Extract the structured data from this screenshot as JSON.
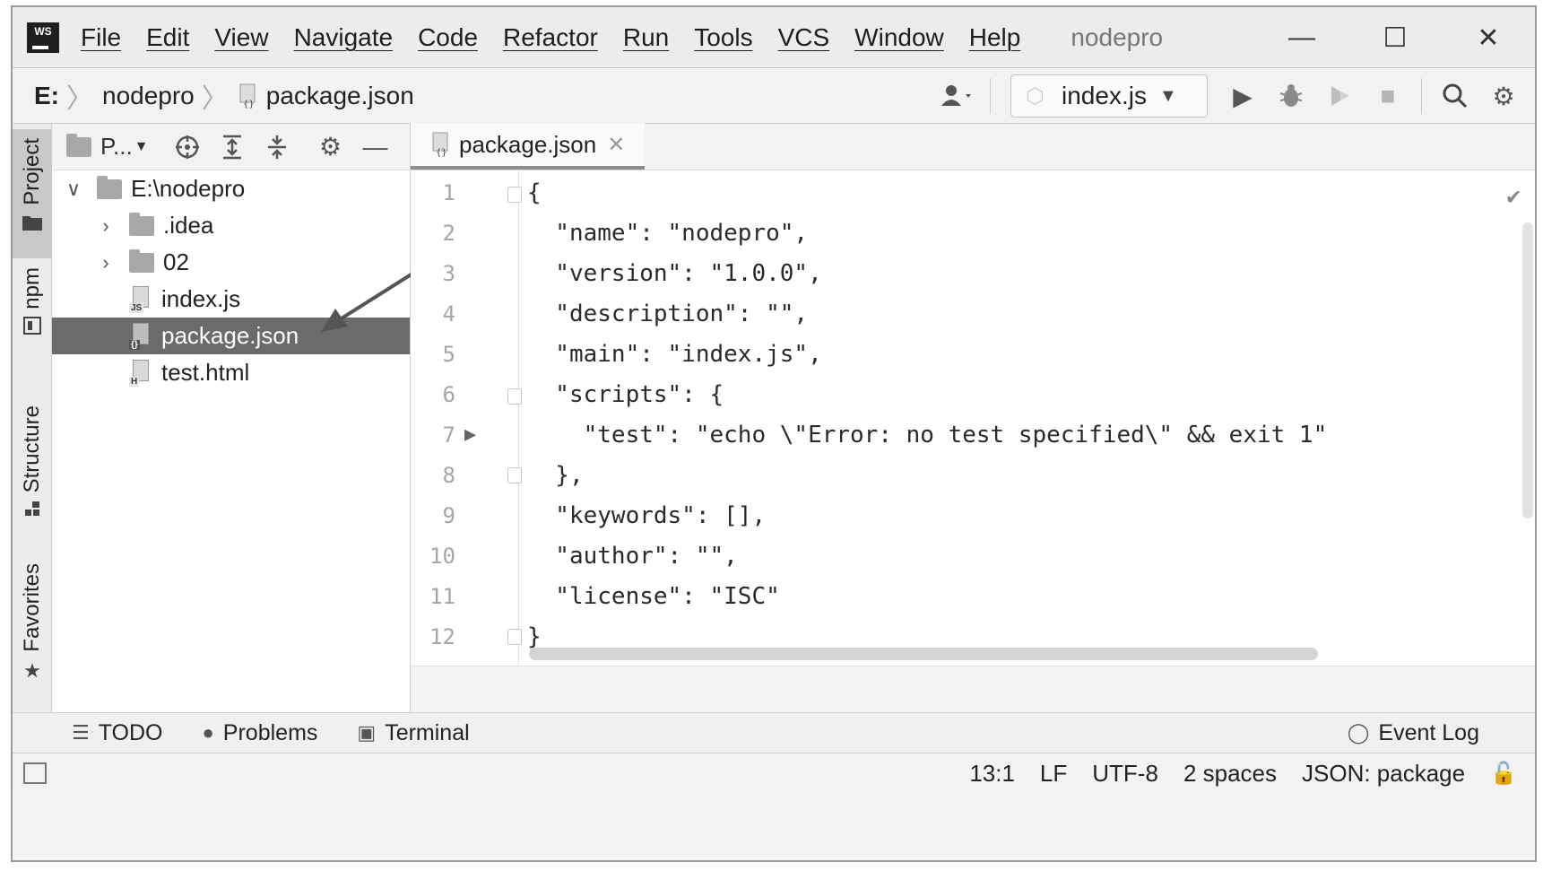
{
  "app": {
    "logo_text": "WS",
    "project_title": "nodepro",
    "menu": [
      "File",
      "Edit",
      "View",
      "Navigate",
      "Code",
      "Refactor",
      "Run",
      "Tools",
      "VCS",
      "Window",
      "Help"
    ],
    "window_controls": [
      "—",
      "☐",
      "✕"
    ]
  },
  "navbar": {
    "drive": "E:",
    "crumbs": [
      "nodepro",
      "package.json"
    ],
    "run_config": "index.js"
  },
  "left_strip": {
    "tabs": [
      "Project",
      "npm",
      "Structure",
      "Favorites"
    ]
  },
  "project_panel": {
    "view_label": "P...",
    "tree": [
      {
        "label": "E:\\nodepro",
        "type": "folder",
        "expanded": true,
        "depth": 0
      },
      {
        "label": ".idea",
        "type": "folder",
        "expanded": false,
        "depth": 1
      },
      {
        "label": "02",
        "type": "folder",
        "expanded": false,
        "depth": 1
      },
      {
        "label": "index.js",
        "type": "file",
        "tag": "JS",
        "depth": 1
      },
      {
        "label": "package.json",
        "type": "file",
        "tag": "{}",
        "depth": 1,
        "selected": true
      },
      {
        "label": "test.html",
        "type": "file",
        "tag": "H",
        "depth": 1
      }
    ]
  },
  "editor": {
    "tab_label": "package.json",
    "lines": [
      {
        "no": "1",
        "text": "{"
      },
      {
        "no": "2",
        "text": "  \"name\": \"nodepro\","
      },
      {
        "no": "3",
        "text": "  \"version\": \"1.0.0\","
      },
      {
        "no": "4",
        "text": "  \"description\": \"\","
      },
      {
        "no": "5",
        "text": "  \"main\": \"index.js\","
      },
      {
        "no": "6",
        "text": "  \"scripts\": {"
      },
      {
        "no": "7",
        "text": "    \"test\": \"echo \\\"Error: no test specified\\\" && exit 1\""
      },
      {
        "no": "8",
        "text": "  },"
      },
      {
        "no": "9",
        "text": "  \"keywords\": [],"
      },
      {
        "no": "10",
        "text": "  \"author\": \"\","
      },
      {
        "no": "11",
        "text": "  \"license\": \"ISC\""
      },
      {
        "no": "12",
        "text": "}"
      }
    ]
  },
  "bottom_tools": {
    "todo": "TODO",
    "problems": "Problems",
    "terminal": "Terminal",
    "event_log": "Event Log"
  },
  "status": {
    "position": "13:1",
    "line_sep": "LF",
    "encoding": "UTF-8",
    "indent": "2 spaces",
    "schema": "JSON: package"
  }
}
